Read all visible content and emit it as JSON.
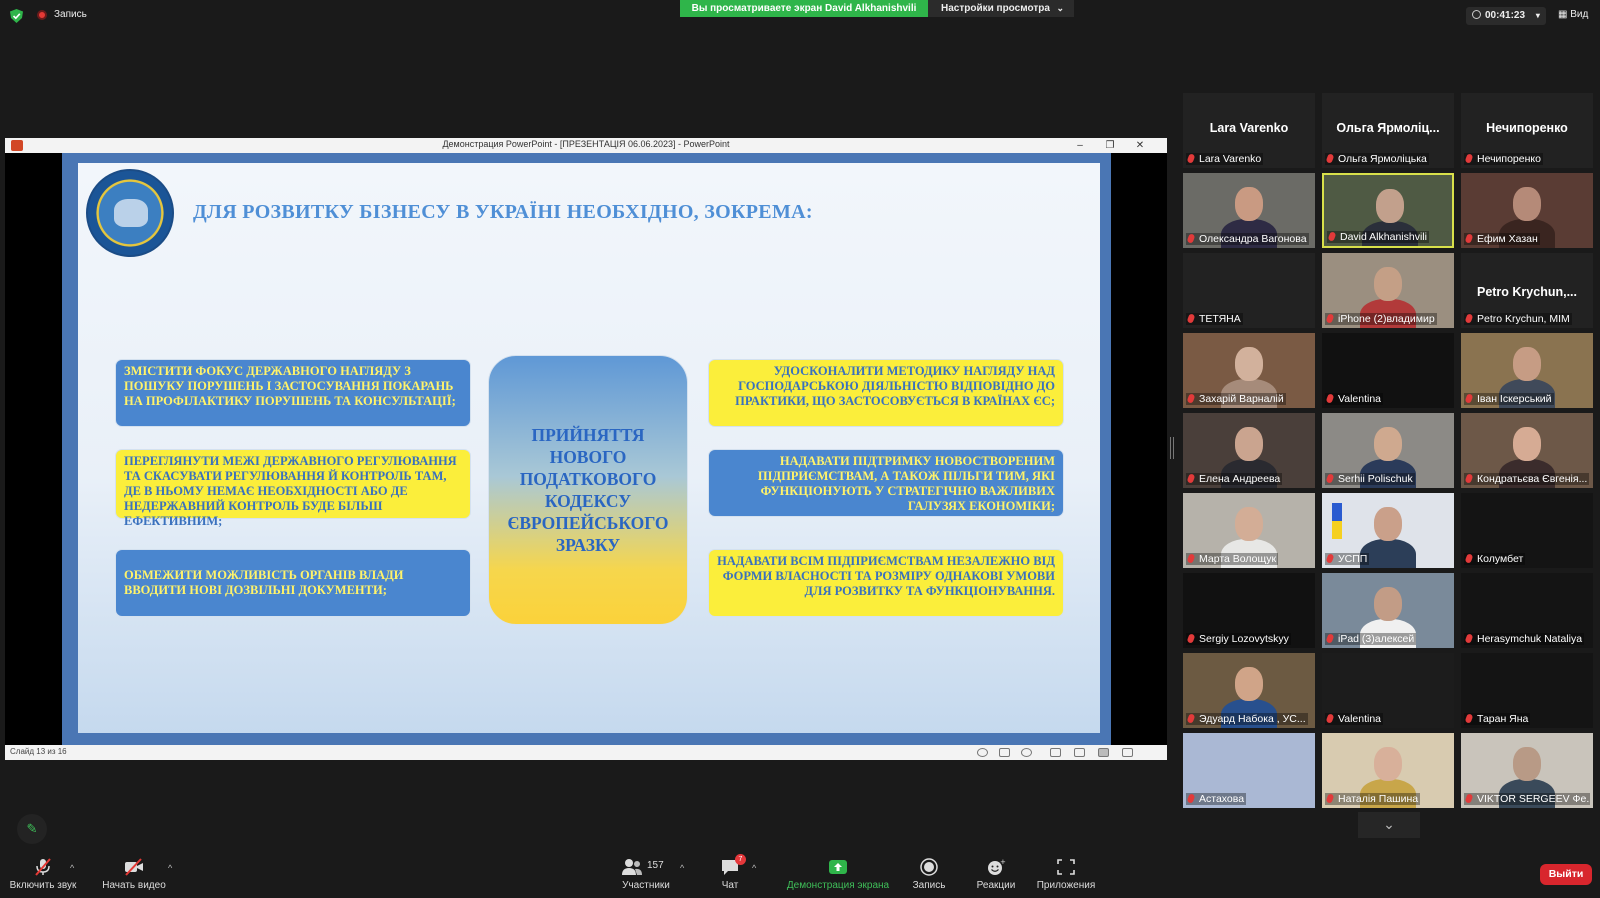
{
  "top_bar": {
    "record_label": "Запись",
    "viewing_banner": "Вы просматриваете экран David Alkhanishvili",
    "view_settings": "Настройки просмотра",
    "timer": "00:41:23",
    "view_label": "Вид"
  },
  "ppt": {
    "window_title": "Демонстрация PowerPoint - [ПРЕЗЕНТАЦІЯ 06.06.2023] - PowerPoint",
    "slide_counter": "Слайд 13 из 16",
    "slide": {
      "heading": "ДЛЯ РОЗВИТКУ БІЗНЕСУ В УКРАЇНІ НЕОБХІДНО, ЗОКРЕМА:",
      "center": "ПРИЙНЯТТЯ НОВОГО ПОДАТКОВОГО КОДЕКСУ ЄВРОПЕЙСЬКОГО ЗРАЗКУ",
      "left_boxes": [
        "ЗМІСТИТИ ФОКУС ДЕРЖАВНОГО НАГЛЯДУ З ПОШУКУ ПОРУШЕНЬ І ЗАСТОСУВАННЯ ПОКАРАНЬ НА ПРОФІЛАКТИКУ ПОРУШЕНЬ ТА КОНСУЛЬТАЦІЇ;",
        "ПЕРЕГЛЯНУТИ МЕЖІ ДЕРЖАВНОГО РЕГУЛЮВАННЯ ТА СКАСУВАТИ РЕГУЛЮВАННЯ Й КОНТРОЛЬ ТАМ, ДЕ В НЬОМУ НЕМАЄ НЕОБХІДНОСТІ АБО ДЕ НЕДЕРЖАВНИЙ КОНТРОЛЬ БУДЕ БІЛЬШ ЕФЕКТИВНИМ;",
        "ОБМЕЖИТИ МОЖЛИВІСТЬ ОРГАНІВ ВЛАДИ ВВОДИТИ НОВІ ДОЗВІЛЬНІ ДОКУМЕНТИ;"
      ],
      "right_boxes": [
        "УДОСКОНАЛИТИ МЕТОДИКУ НАГЛЯДУ НАД ГОСПОДАРСЬКОЮ ДІЯЛЬНІСТЮ ВІДПОВІДНО ДО ПРАКТИКИ, ЩО ЗАСТОСОВУЄТЬСЯ В КРАЇНАХ ЄС;",
        "НАДАВАТИ ПІДТРИМКУ НОВОСТВОРЕНИМ ПІДПРИЄМСТВАМ, А ТАКОЖ ПІЛЬГИ ТИМ, ЯКІ ФУНКЦІОНУЮТЬ У СТРАТЕГІЧНО ВАЖЛИВИХ ГАЛУЗЯХ ЕКОНОМІКИ;",
        "НАДАВАТИ ВСІМ ПІДПРИЄМСТВАМ НЕЗАЛЕЖНО ВІД ФОРМИ ВЛАСНОСТІ ТА РОЗМІРУ ОДНАКОВІ УМОВИ ДЛЯ РОЗВИТКУ ТА ФУНКЦІОНУВАННЯ."
      ]
    }
  },
  "participants": [
    {
      "big": "Lara Varenko",
      "label": "Lara Varenko"
    },
    {
      "big": "Ольга Ярмоліц...",
      "label": "Ольга Ярмоліцька"
    },
    {
      "big": "Нечипоренко",
      "label": "Нечипоренко"
    },
    {
      "big": "",
      "label": "Олександра Вагонова"
    },
    {
      "big": "",
      "label": "David Alkhanishvili"
    },
    {
      "big": "",
      "label": "Ефим Хазан"
    },
    {
      "big": "",
      "label": "ТЕТЯНА"
    },
    {
      "big": "",
      "label": "iPhone (2)владимир"
    },
    {
      "big": "Petro Krychun,...",
      "label": "Petro Krychun, MIM"
    },
    {
      "big": "",
      "label": "Захарій Варналій"
    },
    {
      "big": "",
      "label": "Valentina"
    },
    {
      "big": "",
      "label": "Іван Іскерський"
    },
    {
      "big": "",
      "label": "Елена Андреева"
    },
    {
      "big": "",
      "label": "Serhii Polischuk"
    },
    {
      "big": "",
      "label": "Кондратьєва Євгенія..."
    },
    {
      "big": "",
      "label": "Марта Волощук"
    },
    {
      "big": "",
      "label": "УСПП"
    },
    {
      "big": "",
      "label": "Колумбет"
    },
    {
      "big": "",
      "label": "Sergiy Lozovytskyy"
    },
    {
      "big": "",
      "label": "iPad (3)алексей"
    },
    {
      "big": "",
      "label": "Herasymchuk Nataliya"
    },
    {
      "big": "",
      "label": "Эдуард Набока , УС..."
    },
    {
      "big": "",
      "label": "Valentina"
    },
    {
      "big": "",
      "label": "Таран Яна"
    },
    {
      "big": "",
      "label": "Астахова"
    },
    {
      "big": "",
      "label": "Наталія Пашина"
    },
    {
      "big": "",
      "label": "VIKTOR SERGEEV Фе..."
    }
  ],
  "toolbar": {
    "unmute": "Включить звук",
    "start_video": "Начать видео",
    "participants": "Участники",
    "participants_count": "157",
    "chat": "Чат",
    "chat_badge": "7",
    "share_screen": "Демонстрация экрана",
    "record": "Запись",
    "reactions": "Реакции",
    "apps": "Приложения",
    "leave": "Выйти"
  },
  "colors": {
    "share_green": "#2fb54a",
    "leave_red": "#d8262d",
    "active_speaker": "#d8e04a"
  }
}
